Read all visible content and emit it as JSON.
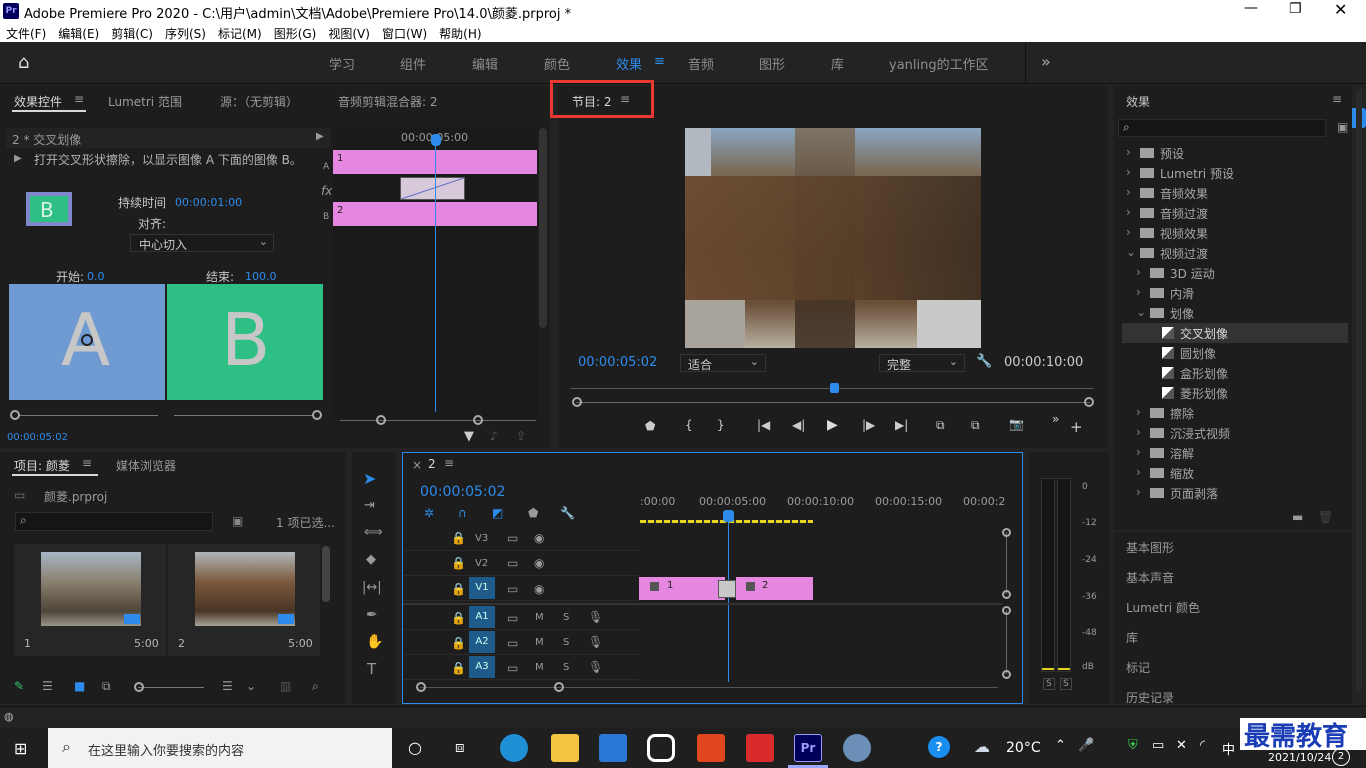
{
  "window": {
    "title": "Adobe Premiere Pro 2020 - C:\\用户\\admin\\文档\\Adobe\\Premiere Pro\\14.0\\颜菱.prproj *",
    "app_icon": "Pr"
  },
  "menu": [
    "文件(F)",
    "编辑(E)",
    "剪辑(C)",
    "序列(S)",
    "标记(M)",
    "图形(G)",
    "视图(V)",
    "窗口(W)",
    "帮助(H)"
  ],
  "workspaces": [
    "学习",
    "组件",
    "编辑",
    "颜色",
    "效果",
    "音频",
    "图形",
    "库",
    "yanling的工作区"
  ],
  "active_workspace": "效果",
  "effect_controls": {
    "tabs": [
      "效果控件",
      "Lumetri 范围",
      "源：（无剪辑）",
      "音频剪辑混合器: 2"
    ],
    "clip_label": "2 * 交叉划像",
    "description": "打开交叉形状擦除，以显示图像 A 下面的图像 B。",
    "duration_label": "持续时间",
    "duration_value": "00:00:01:00",
    "align_label": "对齐:",
    "align_value": "中心切入",
    "start_label": "开始:",
    "start_value": "0.0",
    "end_label": "结束:",
    "end_value": "100.0",
    "preview_a": "A",
    "preview_b": "B",
    "thumb_b": "B",
    "timecode": "00:00:05:02",
    "mini_ruler": "00:00:05:00",
    "mini_a": "A",
    "mini_b": "B",
    "mini_fx": "fx",
    "mini_clip1": "1",
    "mini_clip2": "2"
  },
  "program_monitor": {
    "tab": "节目: 2",
    "timecode": "00:00:05:02",
    "fit": "适合",
    "quality": "完整",
    "duration": "00:00:10:00"
  },
  "project": {
    "tabs": [
      "项目: 颜菱",
      "媒体浏览器"
    ],
    "file": "颜菱.prproj",
    "selected_count": "1 项已选...",
    "items": [
      {
        "name": "1",
        "duration": "5:00"
      },
      {
        "name": "2",
        "duration": "5:00"
      }
    ]
  },
  "timeline": {
    "tab": "2",
    "close": "×",
    "timecode": "00:00:05:02",
    "ruler": [
      ":00:00",
      "00:00:05:00",
      "00:00:10:00",
      "00:00:15:00",
      "00:00:2"
    ],
    "video_tracks": [
      "V3",
      "V2",
      "V1"
    ],
    "audio_tracks": [
      "A1",
      "A2",
      "A3"
    ],
    "mute": "M",
    "solo": "S",
    "clip1": "1",
    "clip2": "2"
  },
  "meter": {
    "scale": [
      "0",
      "-12",
      "-24",
      "-36",
      "-48",
      "dB"
    ],
    "solo": [
      "S",
      "S"
    ]
  },
  "effects_panel": {
    "title": "效果",
    "tree": [
      {
        "label": "预设",
        "level": 0,
        "type": "folder"
      },
      {
        "label": "Lumetri 预设",
        "level": 0,
        "type": "folder"
      },
      {
        "label": "音频效果",
        "level": 0,
        "type": "folder"
      },
      {
        "label": "音频过渡",
        "level": 0,
        "type": "folder"
      },
      {
        "label": "视频效果",
        "level": 0,
        "type": "folder"
      },
      {
        "label": "视频过渡",
        "level": 0,
        "type": "folder-open"
      },
      {
        "label": "3D 运动",
        "level": 1,
        "type": "folder"
      },
      {
        "label": "内滑",
        "level": 1,
        "type": "folder"
      },
      {
        "label": "划像",
        "level": 1,
        "type": "folder-open"
      },
      {
        "label": "交叉划像",
        "level": 2,
        "type": "transition",
        "selected": true
      },
      {
        "label": "圆划像",
        "level": 2,
        "type": "transition"
      },
      {
        "label": "盒形划像",
        "level": 2,
        "type": "transition"
      },
      {
        "label": "菱形划像",
        "level": 2,
        "type": "transition"
      },
      {
        "label": "擦除",
        "level": 1,
        "type": "folder"
      },
      {
        "label": "沉浸式视频",
        "level": 1,
        "type": "folder"
      },
      {
        "label": "溶解",
        "level": 1,
        "type": "folder"
      },
      {
        "label": "缩放",
        "level": 1,
        "type": "folder"
      },
      {
        "label": "页面剥落",
        "level": 1,
        "type": "folder"
      }
    ],
    "side_panels": [
      "基本图形",
      "基本声音",
      "Lumetri 颜色",
      "库",
      "标记",
      "历史记录"
    ]
  },
  "taskbar": {
    "search_placeholder": "在这里输入你要搜索的内容",
    "weather": "20°C",
    "ime": "中",
    "date": "2021/10/24",
    "watermark": "最需教育",
    "badge": "2"
  },
  "colors": {
    "accent": "#2d8ceb",
    "clip_pink": "#e586e0",
    "highlight_box": "#e83a32",
    "track_blue": "#1e5b8a",
    "preview_a": "#6f9bd2",
    "preview_b": "#2ebf85"
  }
}
